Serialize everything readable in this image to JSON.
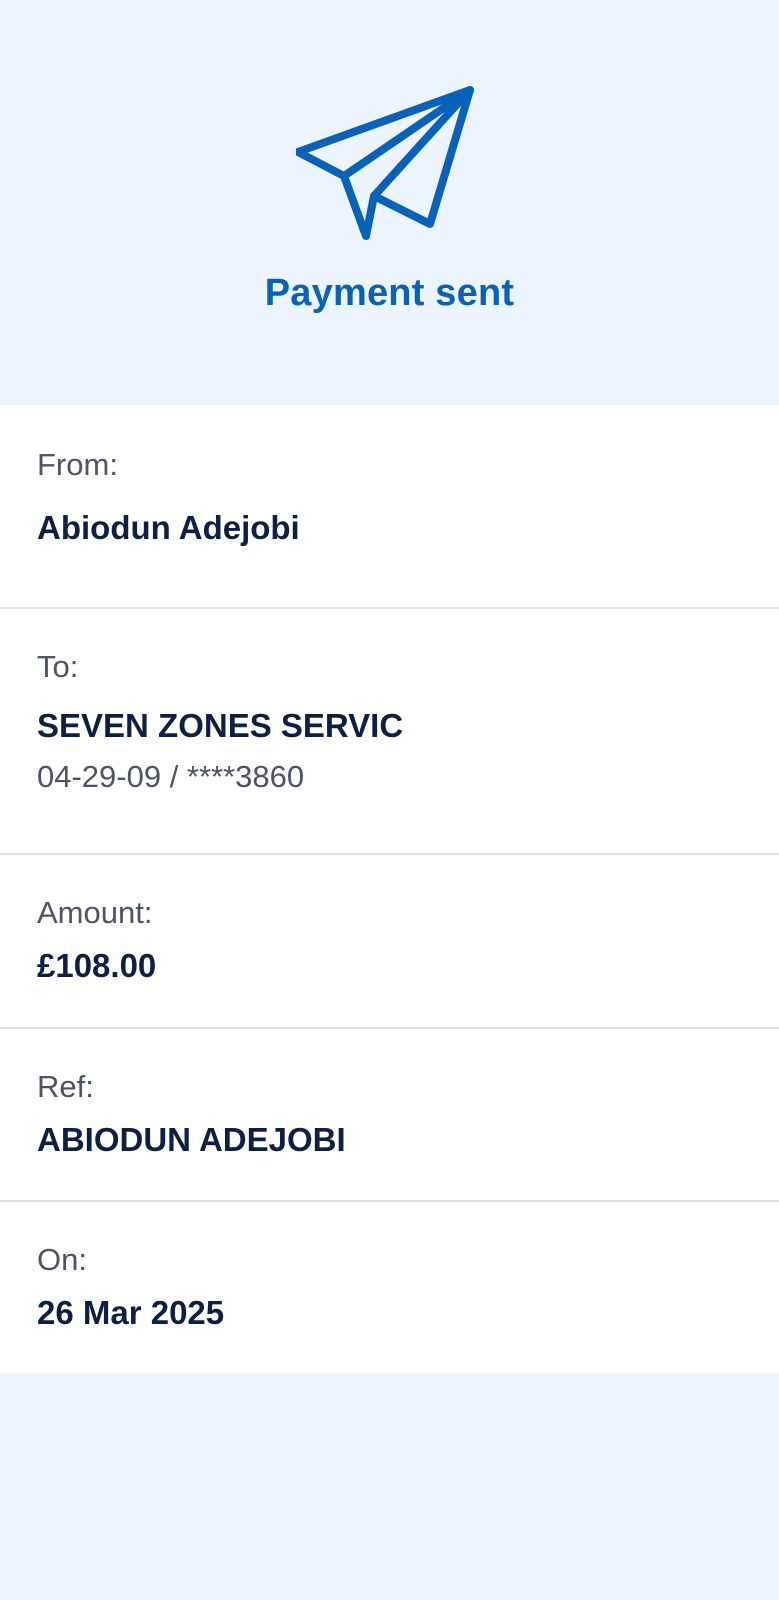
{
  "header": {
    "icon": "paper-plane-icon",
    "title": "Payment sent",
    "accent_color": "#0a62b8"
  },
  "details": {
    "from": {
      "label": "From:",
      "value": "Abiodun Adejobi"
    },
    "to": {
      "label": "To:",
      "value": "SEVEN ZONES SERVIC",
      "account": "04-29-09 / ****3860"
    },
    "amount": {
      "label": "Amount:",
      "value": "£108.00"
    },
    "ref": {
      "label": "Ref:",
      "value": "ABIODUN ADEJOBI"
    },
    "on": {
      "label": "On:",
      "value": "26 Mar 2025"
    }
  }
}
